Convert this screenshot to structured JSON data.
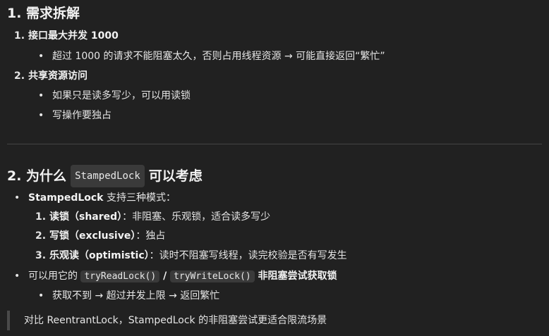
{
  "section1": {
    "title": "1. 需求拆解",
    "items": [
      {
        "num": "1.",
        "label": "接口最大并发 1000",
        "sub": "超过 1000 的请求不能阻塞太久，否则占用线程资源 → 可能直接返回“繁忙”"
      },
      {
        "num": "2.",
        "label": "共享资源访问",
        "subs": [
          "如果只是读多写少，可以用读锁",
          "写操作要独占"
        ]
      }
    ]
  },
  "section2": {
    "title_prefix": "2. 为什么",
    "title_code": "StampedLock",
    "title_suffix": "可以考虑",
    "bullet1_bold": "StampedLock",
    "bullet1_text": " 支持三种模式：",
    "modes": [
      {
        "num": "1.",
        "label": "读锁（shared）",
        "desc": "：非阻塞、乐观锁，适合读多写少"
      },
      {
        "num": "2.",
        "label": "写锁（exclusive）",
        "desc": "：独占"
      },
      {
        "num": "3.",
        "label": "乐观读（optimistic）",
        "desc": "：读时不阻塞写线程，读完校验是否有写发生"
      }
    ],
    "bullet2_pre": "可以用它的 ",
    "code1": "tryReadLock()",
    "slash": " / ",
    "code2": "tryWriteLock()",
    "bullet2_bold": " 非阻塞尝试获取锁",
    "bullet2_sub": "获取不到 → 超过并发上限 → 返回繁忙",
    "quote": "对比 ReentrantLock，StampedLock 的非阻塞尝试更适合限流场景"
  }
}
